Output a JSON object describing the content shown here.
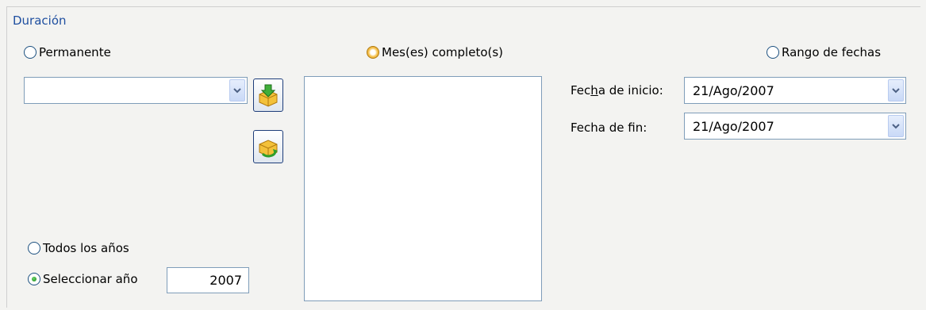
{
  "group": {
    "title": "Duración"
  },
  "radios": {
    "permanente": {
      "label": "Permanente",
      "checked": false
    },
    "meses": {
      "label": "Mes(es) completo(s)",
      "checked": false,
      "hover": true
    },
    "rango": {
      "label": "Rango de fechas",
      "checked": false
    },
    "todos": {
      "label": "Todos los años",
      "checked": false
    },
    "seleccionar": {
      "label": "Seleccionar año",
      "checked": true
    }
  },
  "permanente_combo": {
    "value": ""
  },
  "buttons": {
    "add_icon": "box-add-arrow-icon",
    "refresh_icon": "box-refresh-icon"
  },
  "months_list": {
    "items": []
  },
  "fechas": {
    "inicio_label_pre": "Fec",
    "inicio_label_key": "h",
    "inicio_label_post": "a de inicio:",
    "inicio_value": "21/Ago/2007",
    "fin_label_pre": "Fecha de f",
    "fin_label_key": "i",
    "fin_label_post": "n:",
    "fin_value": "21/Ago/2007"
  },
  "year": {
    "value": "2007"
  },
  "colors": {
    "title": "#1f4fa0",
    "border": "#7f9db9",
    "background": "#f3f3f1"
  }
}
